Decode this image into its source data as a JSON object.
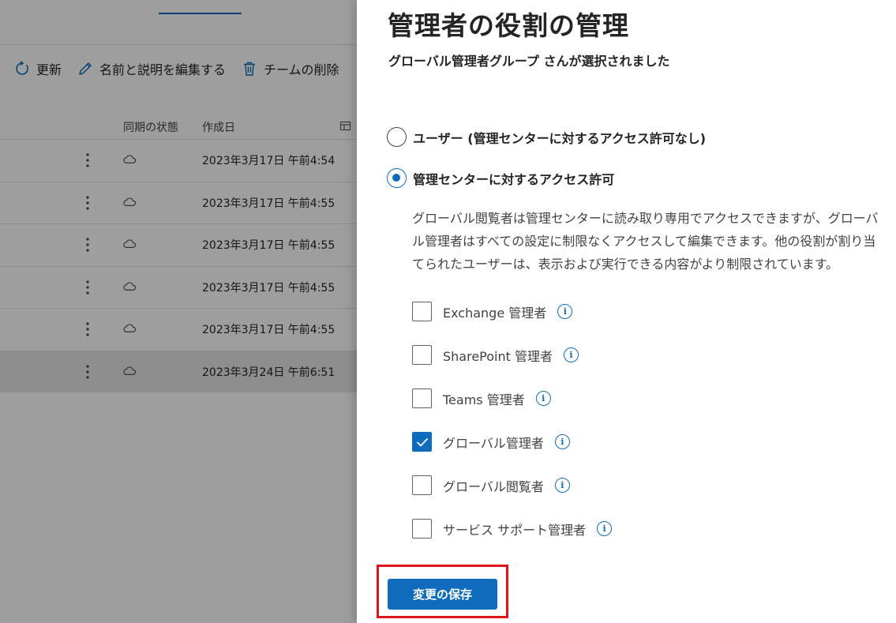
{
  "background": {
    "toolbar": {
      "refresh_label": "更新",
      "edit_label": "名前と説明を編集する",
      "delete_label": "チームの削除"
    },
    "columns": {
      "sync_status": "同期の状態",
      "created": "作成日"
    },
    "rows": [
      {
        "created": "2023年3月17日 午前4:54",
        "selected": false
      },
      {
        "created": "2023年3月17日 午前4:55",
        "selected": false
      },
      {
        "created": "2023年3月17日 午前4:55",
        "selected": false
      },
      {
        "created": "2023年3月17日 午前4:55",
        "selected": false
      },
      {
        "created": "2023年3月17日 午前4:55",
        "selected": false
      },
      {
        "created": "2023年3月24日 午前6:51",
        "selected": true
      }
    ]
  },
  "panel": {
    "title": "管理者の役割の管理",
    "subtitle": "グローバル管理者グループ さんが選択されました",
    "radio_user": {
      "label": "ユーザー (管理センターに対するアクセス許可なし)",
      "checked": false
    },
    "radio_access": {
      "label": "管理センターに対するアクセス許可",
      "checked": true
    },
    "access_description": "グローバル閲覧者は管理センターに読み取り専用でアクセスできますが、グローバル管理者はすべての設定に制限なくアクセスして編集できます。他の役割が割り当てられたユーザーは、表示および実行できる内容がより制限されています。",
    "roles": [
      {
        "label": "Exchange 管理者",
        "checked": false
      },
      {
        "label": "SharePoint 管理者",
        "checked": false
      },
      {
        "label": "Teams 管理者",
        "checked": false
      },
      {
        "label": "グローバル管理者",
        "checked": true
      },
      {
        "label": "グローバル閲覧者",
        "checked": false
      },
      {
        "label": "サービス サポート管理者",
        "checked": false
      }
    ],
    "info_glyph": "i",
    "save_label": "変更の保存"
  },
  "colors": {
    "accent": "#0f6cbd",
    "highlight": "#e0141e",
    "overlay": "rgba(0,0,0,0.38)"
  }
}
